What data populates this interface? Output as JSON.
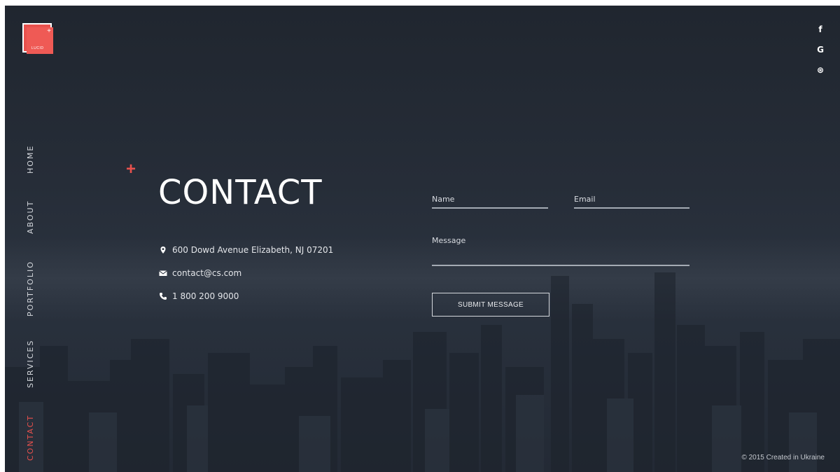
{
  "logo": {
    "text": "LUCID"
  },
  "social": [
    {
      "icon": "facebook-icon",
      "glyph": "f"
    },
    {
      "icon": "google-icon",
      "glyph": "G"
    },
    {
      "icon": "dribbble-icon",
      "glyph": "⊛"
    }
  ],
  "nav": {
    "items": [
      {
        "label": "HOME"
      },
      {
        "label": "ABOUT"
      },
      {
        "label": "PORTFOLIO"
      },
      {
        "label": "SERVICES"
      },
      {
        "label": "CONTACT",
        "active": true
      }
    ]
  },
  "heading": {
    "plus": "+",
    "title": "CONTACT"
  },
  "contact_info": {
    "address": "600 Dowd Avenue Elizabeth, NJ 07201",
    "email": "contact@cs.com",
    "phone": "1 800 200 9000"
  },
  "form": {
    "name_label": "Name",
    "email_label": "Email",
    "message_label": "Message",
    "submit_label": "SUBMIT MESSAGE"
  },
  "footer": {
    "text": "© 2015 Created in Ukraine"
  },
  "colors": {
    "accent": "#e8514d",
    "background": "#262d38",
    "text": "#ffffff"
  }
}
